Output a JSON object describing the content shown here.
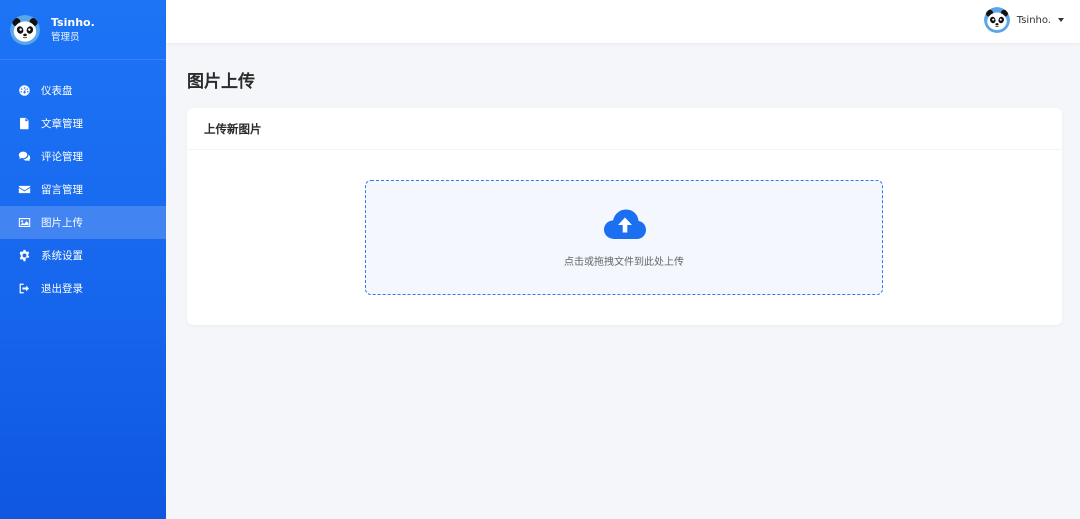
{
  "sidebar": {
    "profile": {
      "name": "Tsinho.",
      "role": "管理员"
    },
    "items": [
      {
        "label": "仪表盘",
        "icon": "dashboard-icon"
      },
      {
        "label": "文章管理",
        "icon": "file-icon"
      },
      {
        "label": "评论管理",
        "icon": "comments-icon"
      },
      {
        "label": "留言管理",
        "icon": "envelope-icon"
      },
      {
        "label": "图片上传",
        "icon": "image-icon",
        "active": true
      },
      {
        "label": "系统设置",
        "icon": "gear-icon"
      },
      {
        "label": "退出登录",
        "icon": "sign-out-icon"
      }
    ]
  },
  "topbar": {
    "user_name": "Tsinho."
  },
  "main": {
    "page_title": "图片上传",
    "card_title": "上传新图片",
    "dropzone_text": "点击或拖拽文件到此处上传"
  },
  "colors": {
    "accent": "#1d74f5",
    "dropzone_border": "#2f7bf2",
    "page_bg": "#f4f6fa"
  }
}
